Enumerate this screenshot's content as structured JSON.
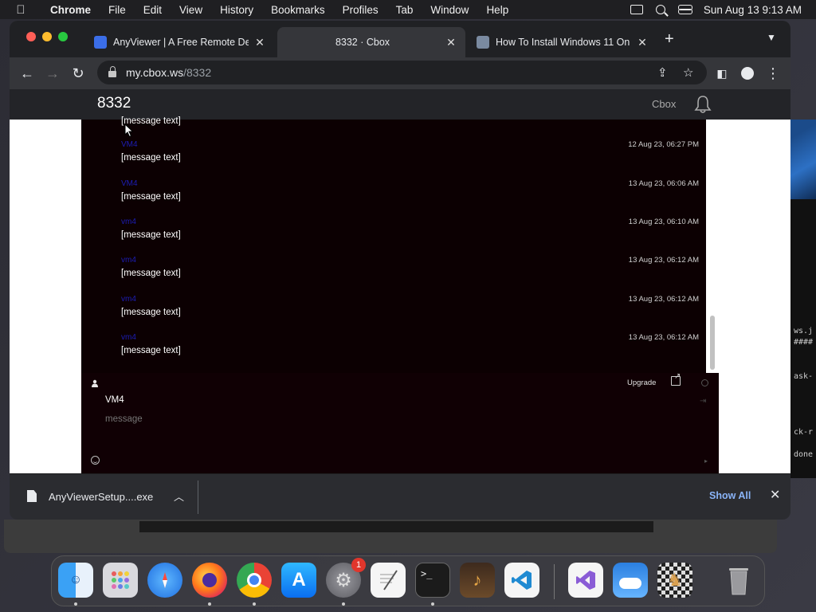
{
  "menubar": {
    "apple": "",
    "items": [
      "Chrome",
      "File",
      "Edit",
      "View",
      "History",
      "Bookmarks",
      "Profiles",
      "Tab",
      "Window",
      "Help"
    ],
    "datetime": "Sun Aug 13  9:13 AM"
  },
  "tabs": [
    {
      "title": "AnyViewer | A Free Remote De",
      "active": false,
      "favicon_color": "#3b6ee8"
    },
    {
      "title": "8332 · Cbox",
      "active": true,
      "favicon_color": ""
    },
    {
      "title": "How To Install Windows 11 On",
      "active": false,
      "favicon_color": "#7a8aa0"
    }
  ],
  "toolbar": {
    "url_host": "my.cbox.ws",
    "url_path": "/8332"
  },
  "page": {
    "room_title": "8332",
    "cbox_link": "Cbox",
    "messages": [
      {
        "name": "",
        "time": "",
        "text": "[message text]"
      },
      {
        "name": "VM4",
        "time": "12 Aug 23, 06:27 PM",
        "text": "[message text]"
      },
      {
        "name": "VM4",
        "time": "13 Aug 23, 06:06 AM",
        "text": "[message text]"
      },
      {
        "name": "vm4",
        "time": "13 Aug 23, 06:10 AM",
        "text": "[message text]"
      },
      {
        "name": "vm4",
        "time": "13 Aug 23, 06:12 AM",
        "text": "[message text]"
      },
      {
        "name": "vm4",
        "time": "13 Aug 23, 06:12 AM",
        "text": "[message text]"
      },
      {
        "name": "vm4",
        "time": "13 Aug 23, 06:12 AM",
        "text": "[message text]"
      }
    ],
    "form": {
      "upgrade_label": "Upgrade",
      "name_value": "VM4",
      "message_placeholder": "message"
    }
  },
  "download": {
    "file_name": "AnyViewerSetup....exe",
    "show_all": "Show All"
  },
  "dock": {
    "apps": [
      "Finder",
      "Launchpad",
      "Safari",
      "Firefox",
      "Chrome",
      "App Store",
      "System Settings",
      "TextEdit",
      "Terminal",
      "GarageBand",
      "Visual Studio Code",
      "Visual Studio",
      "Weather",
      "Chess",
      "Trash"
    ],
    "settings_badge": "1"
  },
  "background_terminal": {
    "lines": [
      "ws.j",
      "####",
      "ask-",
      "ck-r",
      "done"
    ]
  },
  "colors": {
    "chat_bg": "#0c0002",
    "username": "#1d1db5",
    "link_blue": "#8ab4f8"
  }
}
